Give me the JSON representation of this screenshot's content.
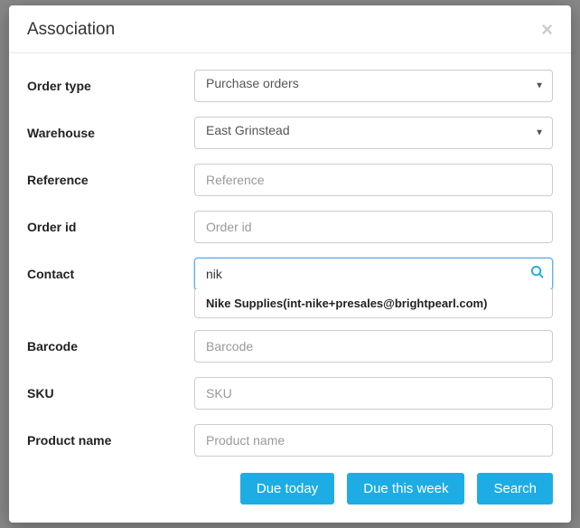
{
  "modal": {
    "title": "Association",
    "fields": {
      "order_type": {
        "label": "Order type",
        "value": "Purchase orders"
      },
      "warehouse": {
        "label": "Warehouse",
        "value": "East Grinstead"
      },
      "reference": {
        "label": "Reference",
        "placeholder": "Reference",
        "value": ""
      },
      "order_id": {
        "label": "Order id",
        "placeholder": "Order id",
        "value": ""
      },
      "contact": {
        "label": "Contact",
        "placeholder": "",
        "value": "nik"
      },
      "barcode": {
        "label": "Barcode",
        "placeholder": "Barcode",
        "value": ""
      },
      "sku": {
        "label": "SKU",
        "placeholder": "SKU",
        "value": ""
      },
      "product_name": {
        "label": "Product name",
        "placeholder": "Product name",
        "value": ""
      }
    },
    "autocomplete": {
      "items": [
        "Nike Supplies(int-nike+presales@brightpearl.com)"
      ]
    },
    "buttons": {
      "due_today": "Due today",
      "due_this_week": "Due this week",
      "search": "Search"
    }
  }
}
